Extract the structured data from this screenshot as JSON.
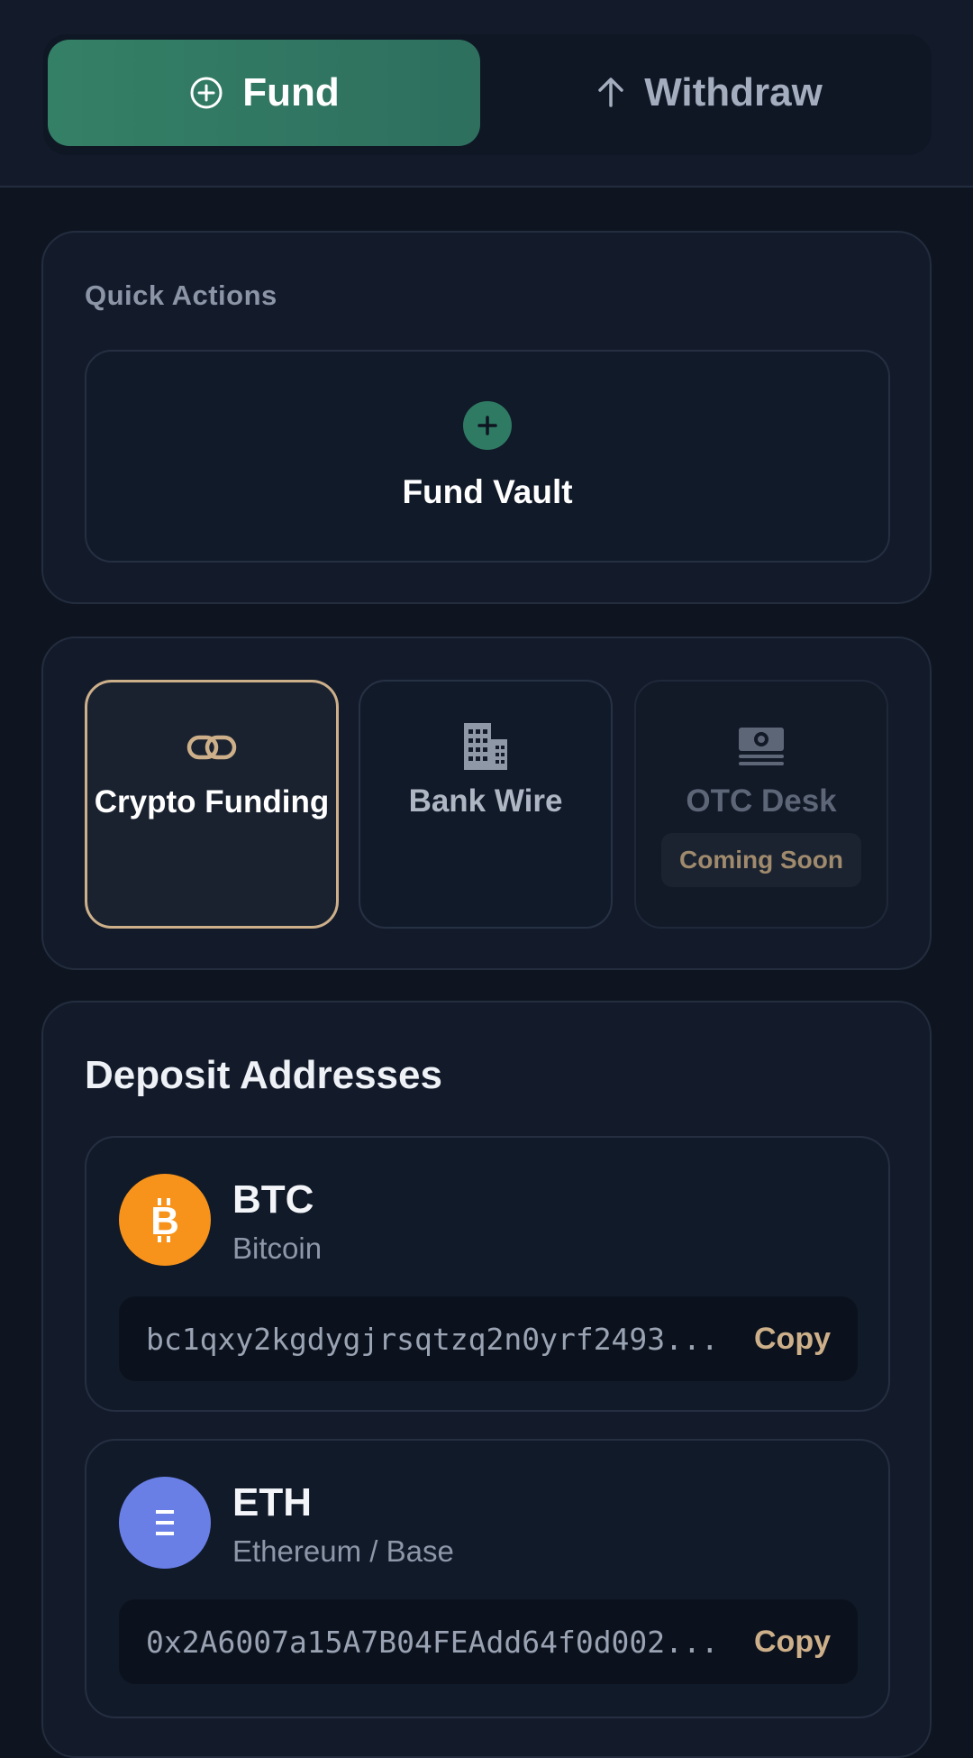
{
  "tabs": {
    "fund_label": "Fund",
    "withdraw_label": "Withdraw",
    "active": "fund"
  },
  "quick_actions": {
    "title": "Quick Actions",
    "fund_vault_label": "Fund Vault",
    "fund_vault_icon": "plus-icon"
  },
  "funding_methods": [
    {
      "label": "Crypto Funding",
      "icon": "link-icon",
      "selected": true
    },
    {
      "label": "Bank Wire",
      "icon": "building-icon",
      "selected": false
    },
    {
      "label": "OTC Desk",
      "icon": "cash-icon",
      "selected": false,
      "badge": "Coming Soon"
    }
  ],
  "deposit": {
    "title": "Deposit Addresses",
    "addresses": [
      {
        "symbol": "BTC",
        "name": "Bitcoin",
        "address": "bc1qxy2kgdygjrsqtzq2n0yrf2493...",
        "copy_label": "Copy",
        "icon": "bitcoin-icon",
        "color": "#f7931a"
      },
      {
        "symbol": "ETH",
        "name": "Ethereum / Base",
        "address": "0x2A6007a15A7B04FEAdd64f0d002...",
        "copy_label": "Copy",
        "icon": "ethereum-icon",
        "color": "#6a7fe6"
      }
    ]
  },
  "colors": {
    "accent_green": "#348066",
    "accent_gold": "#cdb08a",
    "background": "#0e1521",
    "card": "#131b2b"
  }
}
